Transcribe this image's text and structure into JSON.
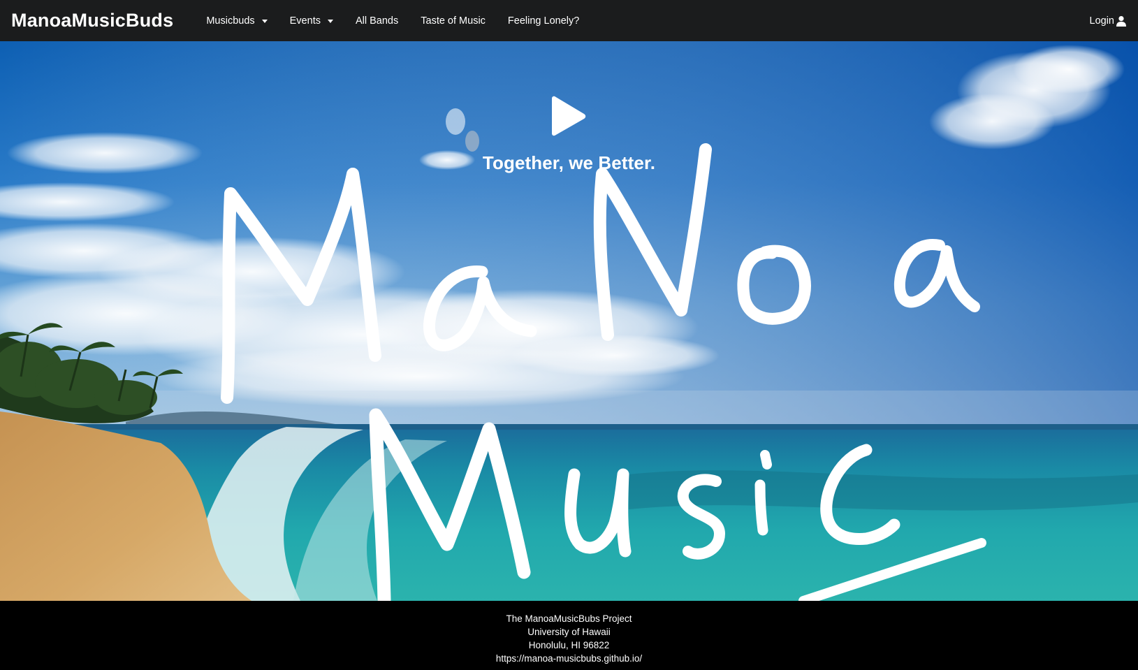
{
  "navbar": {
    "brand": "ManoaMusicBuds",
    "items": [
      {
        "label": "Musicbuds",
        "dropdown": true
      },
      {
        "label": "Events",
        "dropdown": true
      },
      {
        "label": "All Bands",
        "dropdown": false
      },
      {
        "label": "Taste of Music",
        "dropdown": false
      },
      {
        "label": "Feeling Lonely?",
        "dropdown": false
      }
    ],
    "login_label": "Login",
    "login_icon": "user-icon"
  },
  "hero": {
    "play_icon": "play-icon",
    "tagline": "Together, we Better.",
    "handwriting_text": "MaNoa Music"
  },
  "footer": {
    "lines": [
      "The ManoaMusicBubs Project",
      "University of Hawaii",
      "Honolulu, HI 96822"
    ],
    "link": "https://manoa-musicbubs.github.io/"
  },
  "colors": {
    "navbar_bg": "#1b1c1d",
    "footer_bg": "#000000",
    "text": "#ffffff"
  }
}
